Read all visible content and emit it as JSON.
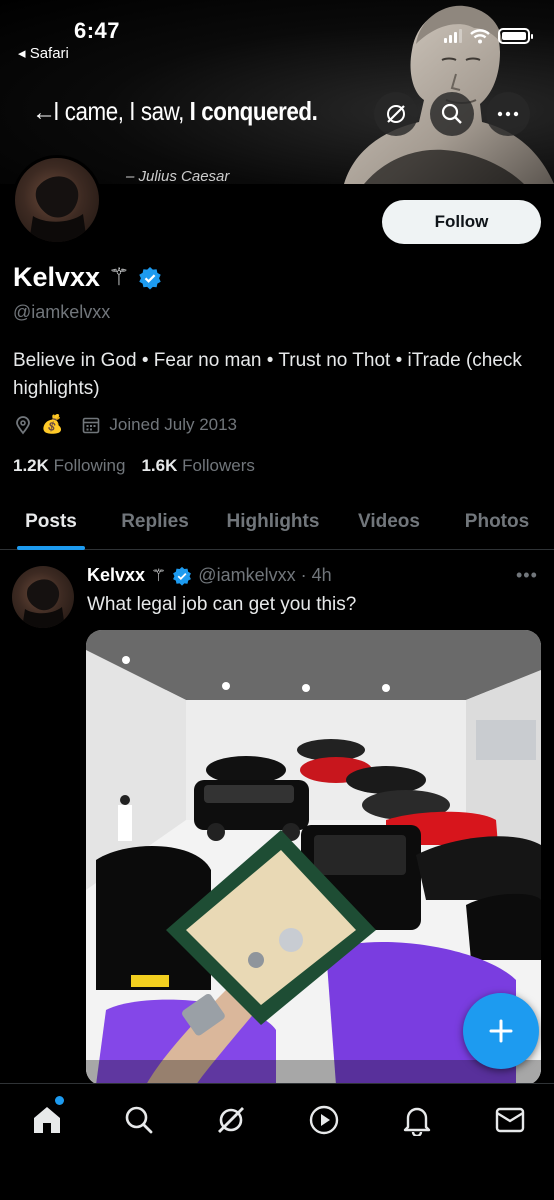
{
  "status_bar": {
    "time": "6:47",
    "back_app": "◂ Safari"
  },
  "banner": {
    "quote_regular": "I came, I saw, ",
    "quote_bold": "I conquered.",
    "author": "– Julius Caesar"
  },
  "profile": {
    "display_name": "Kelvxx",
    "name_emoji": "⚚",
    "handle": "@iamkelvxx",
    "bio": "Believe in God • Fear no man • Trust no Thot • iTrade (check highlights)",
    "location_emoji": "💰",
    "joined": "Joined July 2013",
    "following_count": "1.2K",
    "following_label": "Following",
    "followers_count": "1.6K",
    "followers_label": "Followers",
    "follow_button": "Follow"
  },
  "tabs": [
    {
      "label": "Posts",
      "active": true
    },
    {
      "label": "Replies",
      "active": false
    },
    {
      "label": "Highlights",
      "active": false
    },
    {
      "label": "Videos",
      "active": false
    },
    {
      "label": "Photos",
      "active": false
    }
  ],
  "post": {
    "author_name": "Kelvxx",
    "author_emoji": "⚚",
    "handle_time": "@iamkelvxx · 4h",
    "more": "•••",
    "text": "What legal job can get you this?"
  },
  "colors": {
    "accent": "#1d9bf0",
    "background": "#000000",
    "muted": "#71767b"
  },
  "icons": {
    "nav": [
      "home-icon",
      "search-icon",
      "grok-icon",
      "video-icon",
      "notifications-icon",
      "messages-icon"
    ]
  }
}
